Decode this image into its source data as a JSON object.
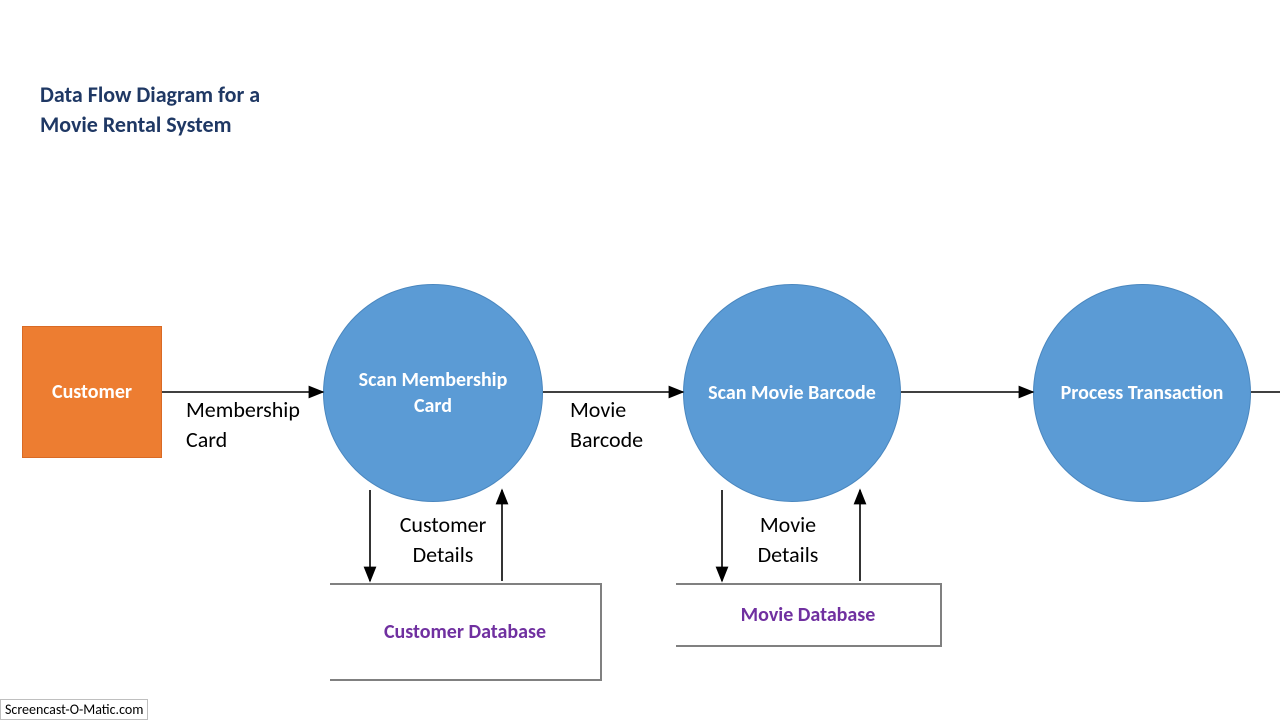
{
  "title": "Data Flow Diagram for a Movie Rental System",
  "entities": {
    "customer": "Customer"
  },
  "processes": {
    "scan_membership": "Scan Membership Card",
    "scan_movie": "Scan Movie Barcode",
    "process_tx": "Process Transaction"
  },
  "datastores": {
    "customer_db": "Customer Database",
    "movie_db": "Movie Database"
  },
  "flows": {
    "membership_card": "Membership Card",
    "movie_barcode": "Movie Barcode",
    "customer_details": "Customer Details",
    "movie_details": "Movie Details"
  },
  "watermark": "Screencast-O-Matic.com"
}
